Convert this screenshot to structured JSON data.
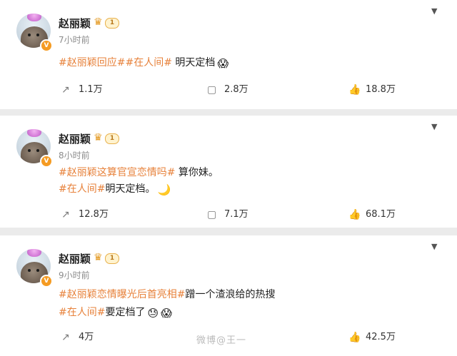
{
  "posts": [
    {
      "username": "赵丽颖",
      "level": "1",
      "time": "7小时前",
      "lines": [
        [
          {
            "text": "#赵丽颖回应##在人间#",
            "tag": true
          },
          {
            "text": " 明天定档",
            "tag": false
          }
        ]
      ],
      "emojis": [
        "😱"
      ],
      "repost": "1.1万",
      "comment": "2.8万",
      "like": "18.8万"
    },
    {
      "username": "赵丽颖",
      "level": "1",
      "time": "8小时前",
      "lines": [
        [
          {
            "text": "#赵丽颖这算官宣恋情吗#",
            "tag": true
          },
          {
            "text": " 算你妹。",
            "tag": false
          }
        ],
        [
          {
            "text": "#在人间#",
            "tag": true
          },
          {
            "text": "明天定档。",
            "tag": false
          }
        ]
      ],
      "emojis": [
        "🌙"
      ],
      "repost": "12.8万",
      "comment": "7.1万",
      "like": "68.1万"
    },
    {
      "username": "赵丽颖",
      "level": "1",
      "time": "9小时前",
      "lines": [
        [
          {
            "text": "#赵丽颖恋情曝光后首亮相#",
            "tag": true
          },
          {
            "text": "蹭一个渣浪给的热搜",
            "tag": false
          }
        ],
        [
          {
            "text": "#在人间#",
            "tag": true
          },
          {
            "text": "要定档了",
            "tag": false
          }
        ]
      ],
      "emojis": [
        "😓",
        "😱"
      ],
      "repost": "4万",
      "comment": "",
      "like": "42.5万"
    }
  ],
  "icons": {
    "repost": "repost-icon",
    "comment": "comment-icon",
    "like": "like-icon",
    "more": "chevron-down-icon",
    "verified": "verified-badge-icon",
    "member": "crown-icon"
  },
  "watermark": "微博@王一",
  "colors": {
    "tag": "#e7813a",
    "background": "#ebebeb",
    "card": "#ffffff",
    "verified": "#f59b22"
  }
}
